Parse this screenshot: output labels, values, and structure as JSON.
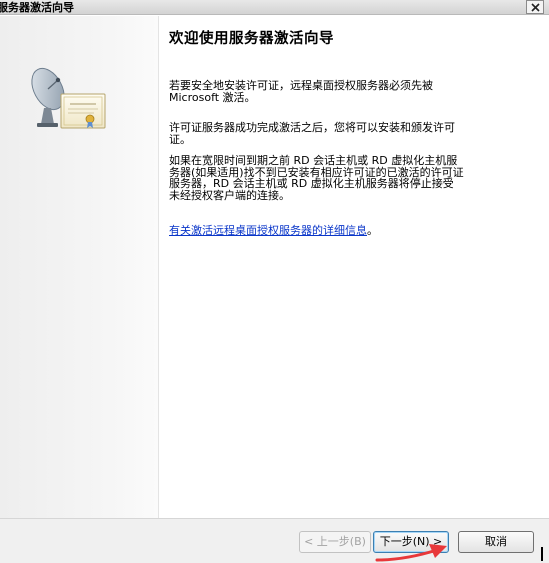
{
  "window": {
    "title": "服务器激活向导"
  },
  "main": {
    "heading": "欢迎使用服务器激活向导",
    "paragraph1": "若要安全地安装许可证，远程桌面授权服务器必须先被 Microsoft 激活。",
    "paragraph2": "许可证服务器成功完成激活之后，您将可以安装和颁发许可证。",
    "paragraph3": "如果在宽限时间到期之前 RD 会话主机或 RD 虚拟化主机服务器(如果适用)找不到已安装有相应许可证的已激活的许可证服务器，RD 会话主机或 RD 虚拟化主机服务器将停止接受未经授权客户端的连接。",
    "link_text": "有关激活远程桌面授权服务器的详细信息",
    "link_suffix": "。"
  },
  "footer": {
    "back_label": "< 上一步(B)",
    "next_label": "下一步(N) >",
    "cancel_label": "取消"
  },
  "colors": {
    "link": "#0a36c9",
    "annotation_arrow": "#e8383a"
  },
  "icons": {
    "close": "close-icon",
    "wizard_art": "satellite-certificate-icon"
  }
}
